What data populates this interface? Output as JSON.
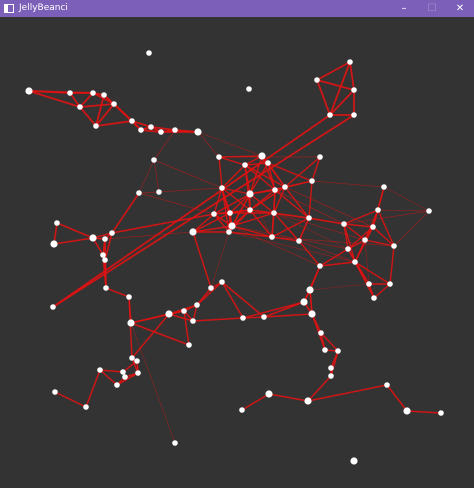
{
  "window": {
    "title": "JellyBeanci",
    "titlebar_color": "#7b5fb8",
    "background_color": "#333333",
    "controls": {
      "minimize": "–",
      "maximize": "☐",
      "close": "✕"
    }
  },
  "graph": {
    "node_color": "#ffffff",
    "edge_color": "#e01212"
  }
}
